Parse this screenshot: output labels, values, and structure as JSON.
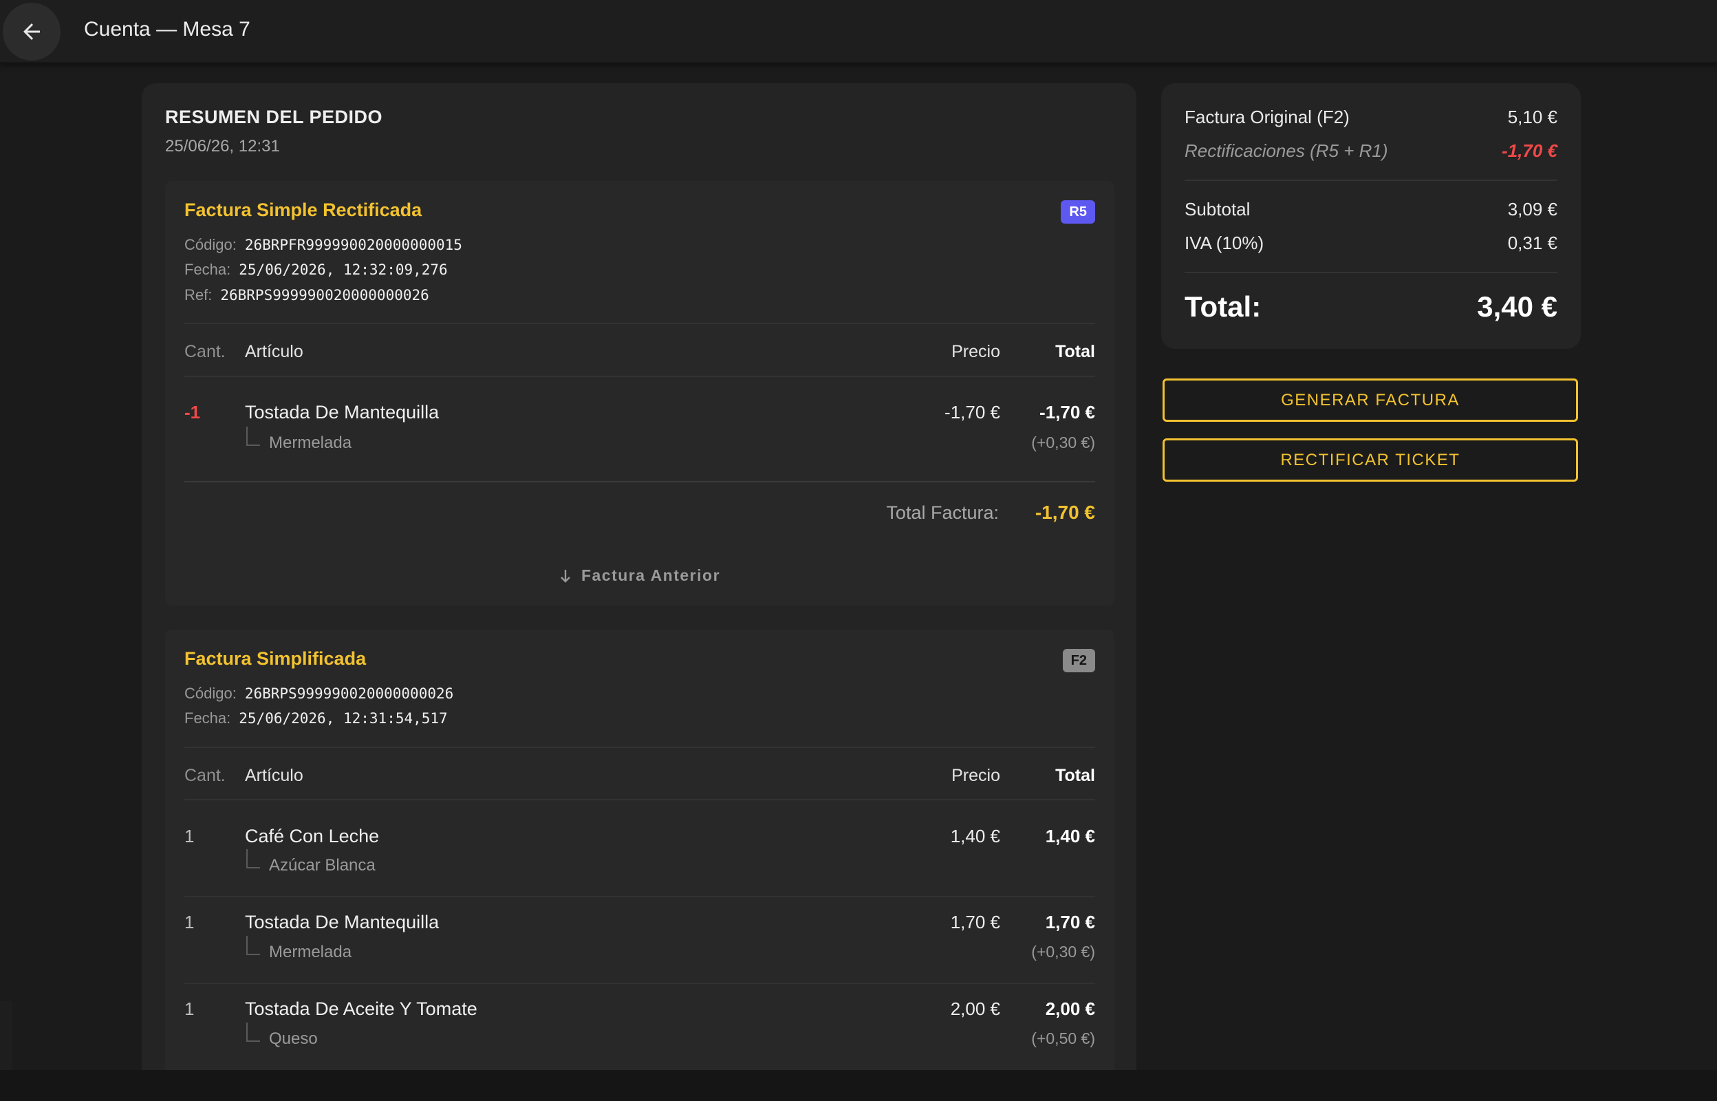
{
  "header": {
    "title": "Cuenta — Mesa 7",
    "back_icon": "arrow-left-icon"
  },
  "order": {
    "heading": "RESUMEN DEL PEDIDO",
    "datetime": "25/06/26, 12:31",
    "columns": {
      "cant": "Cant.",
      "articulo": "Artículo",
      "precio": "Precio",
      "total": "Total"
    },
    "invoices": [
      {
        "title": "Factura Simple Rectificada",
        "badge": "R5",
        "codigo_label": "Código:",
        "codigo": "26BRPFR999990020000000015",
        "fecha_label": "Fecha:",
        "fecha": "25/06/2026, 12:32:09,276",
        "ref_label": "Ref:",
        "ref": "26BRPS999990020000000026",
        "items": [
          {
            "qty": "-1",
            "name": "Tostada De Mantequilla",
            "modifier": "Mermelada",
            "price": "-1,70 €",
            "total": "-1,70 €",
            "extra": "(+0,30 €)"
          }
        ],
        "total_label": "Total Factura:",
        "total": "-1,70 €",
        "prev_link": "Factura Anterior"
      },
      {
        "title": "Factura Simplificada",
        "badge": "F2",
        "codigo_label": "Código:",
        "codigo": "26BRPS999990020000000026",
        "fecha_label": "Fecha:",
        "fecha": "25/06/2026, 12:31:54,517",
        "items": [
          {
            "qty": "1",
            "name": "Café Con Leche",
            "modifier": "Azúcar Blanca",
            "price": "1,40 €",
            "total": "1,40 €"
          },
          {
            "qty": "1",
            "name": "Tostada De Mantequilla",
            "modifier": "Mermelada",
            "price": "1,70 €",
            "total": "1,70 €",
            "extra": "(+0,30 €)"
          },
          {
            "qty": "1",
            "name": "Tostada De Aceite Y Tomate",
            "modifier": "Queso",
            "price": "2,00 €",
            "total": "2,00 €",
            "extra": "(+0,50 €)"
          }
        ]
      }
    ]
  },
  "summary": {
    "original_label": "Factura Original (F2)",
    "original_value": "5,10 €",
    "rect_label": "Rectificaciones (R5 + R1)",
    "rect_value": "-1,70 €",
    "subtotal_label": "Subtotal",
    "subtotal_value": "3,09 €",
    "iva_label": "IVA (10%)",
    "iva_value": "0,31 €",
    "total_label": "Total:",
    "total_value": "3,40 €"
  },
  "actions": {
    "generate": "GENERAR FACTURA",
    "rectify": "RECTIFICAR TICKET"
  },
  "colors": {
    "accent": "#f2c230",
    "negative": "#f04848",
    "badge_r5": "#5d58f0",
    "badge_f2": "#8a8a8a"
  }
}
